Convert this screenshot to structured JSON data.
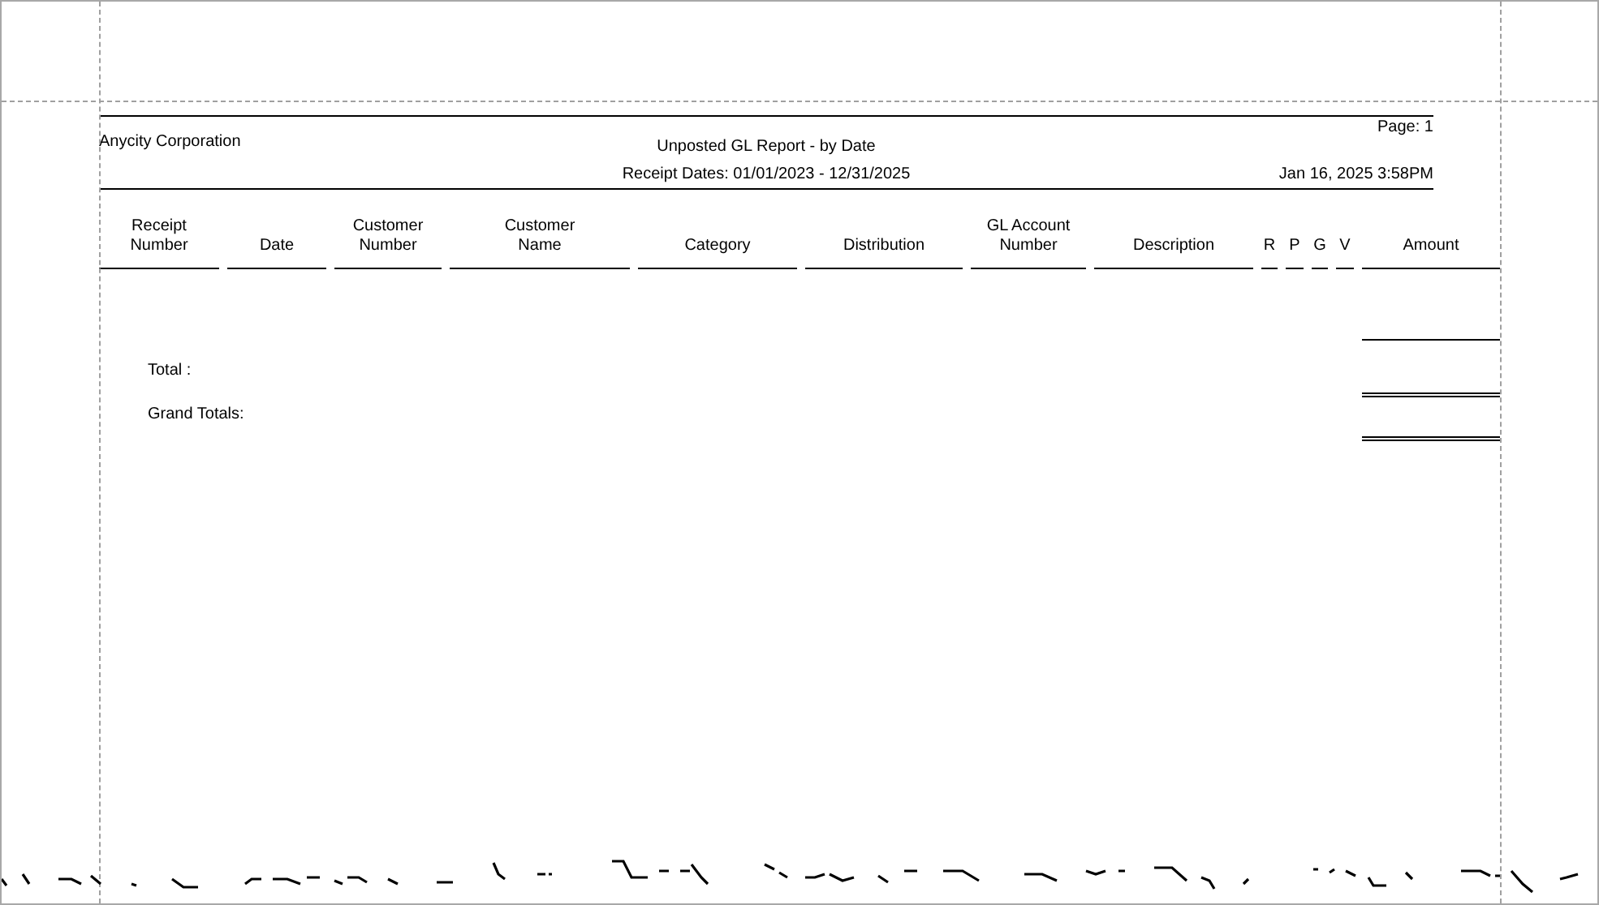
{
  "report": {
    "company": "Anycity Corporation",
    "title": "Unposted GL Report - by Date",
    "subtitle": "Receipt Dates: 01/01/2023 - 12/31/2025",
    "page": "Page: 1",
    "printed": "Jan 16, 2025 3:58PM"
  },
  "columns": [
    {
      "lines": [
        "Receipt",
        "Number"
      ]
    },
    {
      "lines": [
        "Date"
      ]
    },
    {
      "lines": [
        "Customer",
        "Number"
      ]
    },
    {
      "lines": [
        "Customer",
        "Name"
      ]
    },
    {
      "lines": [
        "Category"
      ]
    },
    {
      "lines": [
        "Distribution"
      ]
    },
    {
      "lines": [
        "GL Account",
        "Number"
      ]
    },
    {
      "lines": [
        "Description"
      ]
    },
    {
      "lines": [
        "R"
      ]
    },
    {
      "lines": [
        "P"
      ]
    },
    {
      "lines": [
        "G"
      ]
    },
    {
      "lines": [
        "V"
      ]
    },
    {
      "lines": [
        "Amount"
      ]
    }
  ],
  "totals": [
    {
      "label": "Total :",
      "double_underline": true
    },
    {
      "label": "Grand Totals:",
      "double_underline": true
    }
  ]
}
